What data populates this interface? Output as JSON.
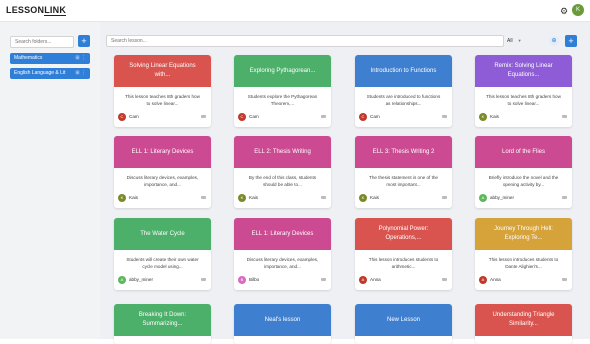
{
  "header": {
    "logo_part1": "LESSON",
    "logo_part2": "LINK",
    "gear_icon": "gear-icon",
    "user_initial": "K"
  },
  "sidebar": {
    "search_placeholder": "Search folders...",
    "add_label": "+",
    "folders": [
      {
        "label": "Mathematics"
      },
      {
        "label": "English Language & Lit"
      }
    ]
  },
  "toolbar": {
    "search_placeholder": "Search lesson...",
    "filter_value": "All",
    "add_label": "+"
  },
  "lessons": [
    {
      "title": "Solving Linear Equations with...",
      "desc": "This lesson teaches 8th graders how to solve linear...",
      "author": "Cam",
      "initial": "C",
      "color": "#d9534f",
      "avatar_color": "#c0392b"
    },
    {
      "title": "Exploring Pythagorean...",
      "desc": "Students explore the Pythagorean Theorem,...",
      "author": "Cam",
      "initial": "C",
      "color": "#4caf6a",
      "avatar_color": "#c0392b"
    },
    {
      "title": "Introduction to Functions",
      "desc": "Students are introduced to functions as relationships...",
      "author": "Cam",
      "initial": "C",
      "color": "#3f7fd0",
      "avatar_color": "#c0392b"
    },
    {
      "title": "Remix: Solving Linear Equations...",
      "desc": "This lesson teaches 8th graders how to solve linear...",
      "author": "Kais",
      "initial": "K",
      "color": "#8e5cd6",
      "avatar_color": "#7a8a2a"
    },
    {
      "title": "ELL 1: Literary Devices",
      "desc": "Discuss literary devices, examples, importance, and...",
      "author": "Kais",
      "initial": "K",
      "color": "#cc4a92",
      "avatar_color": "#7a8a2a"
    },
    {
      "title": "ELL 2: Thesis Writing",
      "desc": "By the end of this class, students should be able to...",
      "author": "Kais",
      "initial": "K",
      "color": "#cc4a92",
      "avatar_color": "#7a8a2a"
    },
    {
      "title": "ELL 3: Thesis Writing 2",
      "desc": "The thesis statement is one of the most important...",
      "author": "Kais",
      "initial": "K",
      "color": "#cc4a92",
      "avatar_color": "#7a8a2a"
    },
    {
      "title": "Lord of the Flies",
      "desc": "Briefly introduce the novel and the opening activity by...",
      "author": "abby_miner",
      "initial": "A",
      "color": "#cc4a92",
      "avatar_color": "#5cb85c"
    },
    {
      "title": "The Water Cycle",
      "desc": "Students will create their own water cycle model using...",
      "author": "abby_miner",
      "initial": "A",
      "color": "#4caf6a",
      "avatar_color": "#5cb85c"
    },
    {
      "title": "ELL 1: Literary Devices",
      "desc": "Discuss literary devices, examples, importance, and...",
      "author": "Bilbo",
      "initial": "B",
      "color": "#cc4a92",
      "avatar_color": "#d96bc2"
    },
    {
      "title": "Polynomial Power: Operations,...",
      "desc": "This lesson introduces students to arithmetic...",
      "author": "Anna",
      "initial": "A",
      "color": "#d9534f",
      "avatar_color": "#c0392b"
    },
    {
      "title": "Journey Through Hell: Exploring Te...",
      "desc": "This lesson introduces students to Dante Alighieri's...",
      "author": "Anna",
      "initial": "A",
      "color": "#d6a23a",
      "avatar_color": "#c0392b"
    },
    {
      "title": "Breaking It Down: Summarizing...",
      "color": "#4caf6a"
    },
    {
      "title": "Neal's lesson",
      "color": "#3f7fd0"
    },
    {
      "title": "New Lesson",
      "color": "#3f7fd0"
    },
    {
      "title": "Understanding Triangle Similarity...",
      "color": "#d9534f"
    }
  ]
}
